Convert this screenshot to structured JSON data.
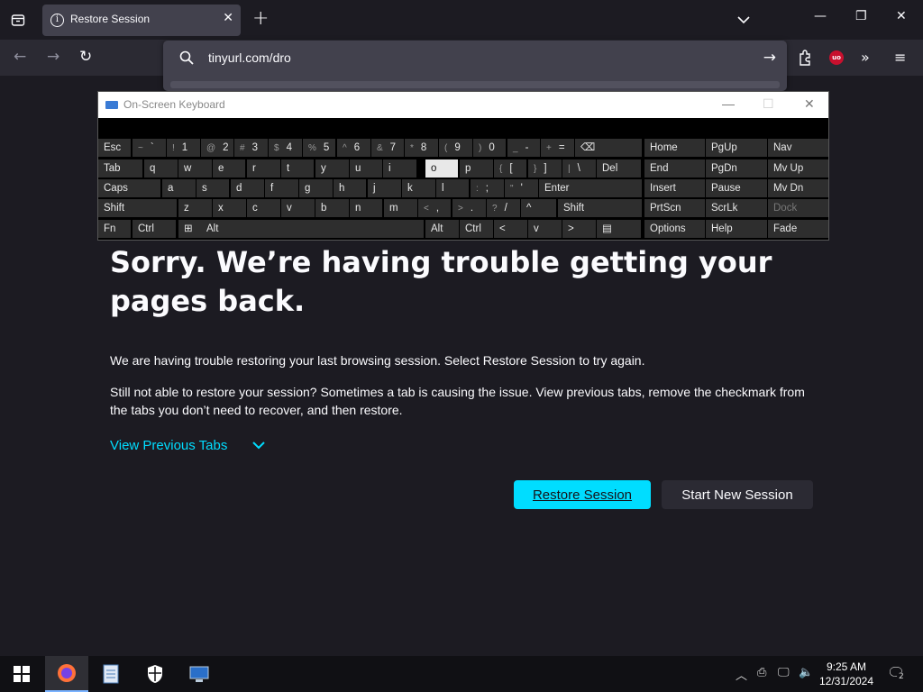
{
  "browser": {
    "tab_title": "Restore Session",
    "url_value": "tinyurl.com/dro"
  },
  "osk": {
    "title": "On-Screen Keyboard",
    "rows": [
      [
        {
          "l": "Esc"
        },
        {
          "s": "~",
          "l": "`"
        },
        {
          "s": "!",
          "l": "1"
        },
        {
          "s": "@",
          "l": "2"
        },
        {
          "s": "#",
          "l": "3"
        },
        {
          "s": "$",
          "l": "4"
        },
        {
          "s": "%",
          "l": "5"
        },
        {
          "s": "^",
          "l": "6"
        },
        {
          "s": "&",
          "l": "7"
        },
        {
          "s": "*",
          "l": "8"
        },
        {
          "s": "(",
          "l": "9"
        },
        {
          "s": ")",
          "l": "0"
        },
        {
          "s": "_",
          "l": "-"
        },
        {
          "s": "+",
          "l": "="
        },
        {
          "l": "⌫"
        }
      ],
      [
        {
          "l": "Tab"
        },
        {
          "l": "q"
        },
        {
          "l": "w"
        },
        {
          "l": "e"
        },
        {
          "l": "r"
        },
        {
          "l": "t"
        },
        {
          "l": "y"
        },
        {
          "l": "u"
        },
        {
          "l": "i"
        },
        {
          "l": "o"
        },
        {
          "l": "p"
        },
        {
          "s": "{",
          "l": "["
        },
        {
          "s": "}",
          "l": "]"
        },
        {
          "s": "|",
          "l": "\\"
        },
        {
          "l": "Del"
        }
      ],
      [
        {
          "l": "Caps"
        },
        {
          "l": "a"
        },
        {
          "l": "s"
        },
        {
          "l": "d"
        },
        {
          "l": "f"
        },
        {
          "l": "g"
        },
        {
          "l": "h"
        },
        {
          "l": "j"
        },
        {
          "l": "k"
        },
        {
          "l": "l"
        },
        {
          "s": ":",
          "l": ";"
        },
        {
          "s": "\"",
          "l": "'"
        },
        {
          "l": "Enter"
        }
      ],
      [
        {
          "l": "Shift"
        },
        {
          "l": "z"
        },
        {
          "l": "x"
        },
        {
          "l": "c"
        },
        {
          "l": "v"
        },
        {
          "l": "b"
        },
        {
          "l": "n"
        },
        {
          "l": "m"
        },
        {
          "s": "<",
          "l": ","
        },
        {
          "s": ">",
          "l": "."
        },
        {
          "s": "?",
          "l": "/"
        },
        {
          "l": "^"
        },
        {
          "l": "Shift"
        }
      ],
      [
        {
          "l": "Fn"
        },
        {
          "l": "Ctrl"
        },
        {
          "l": "⊞"
        },
        {
          "l": "Alt"
        },
        {
          "l": ""
        },
        {
          "l": "Alt"
        },
        {
          "l": "Ctrl"
        },
        {
          "l": "<"
        },
        {
          "l": "v"
        },
        {
          "l": ">"
        },
        {
          "l": "▤"
        }
      ]
    ],
    "nav_rows": [
      [
        "Home",
        "PgUp",
        "Nav"
      ],
      [
        "End",
        "PgDn",
        "Mv Up"
      ],
      [
        "Insert",
        "Pause",
        "Mv Dn"
      ],
      [
        "PrtScn",
        "ScrLk",
        "Dock"
      ],
      [
        "Options",
        "Help",
        "Fade"
      ]
    ]
  },
  "page": {
    "heading": "Sorry. We’re having trouble getting your pages back.",
    "p1": "We are having trouble restoring your last browsing session. Select Restore Session to try again.",
    "p2": "Still not able to restore your session? Sometimes a tab is causing the issue. View previous tabs, remove the checkmark from the tabs you don’t need to recover, and then restore.",
    "view_previous": "View Previous Tabs",
    "restore_btn": "Restore Session",
    "new_session_btn": "Start New Session"
  },
  "taskbar": {
    "time": "9:25 AM",
    "date": "12/31/2024",
    "notif_count": "2"
  },
  "colors": {
    "accent": "#00ddff",
    "bg": "#1c1b22"
  }
}
